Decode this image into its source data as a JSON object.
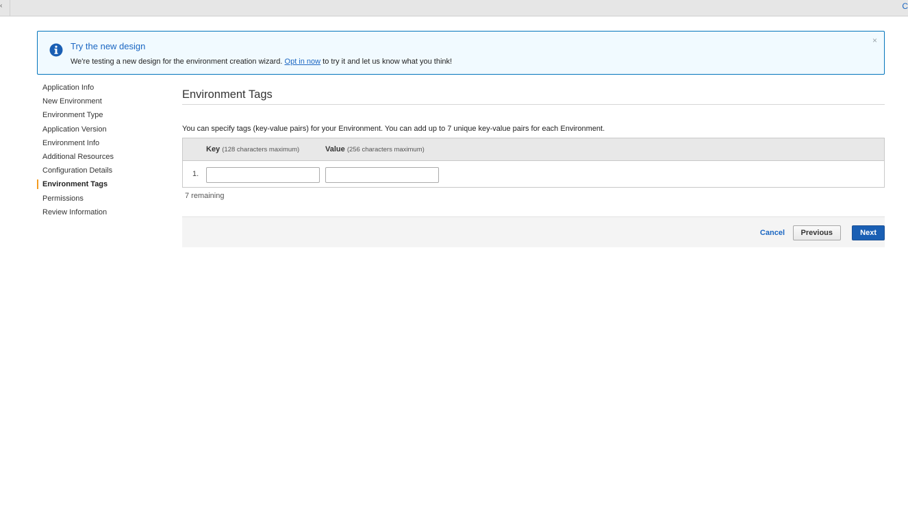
{
  "colors": {
    "accent": "#1a66c2",
    "banner_border": "#0073bb",
    "banner_bg": "#f1faff",
    "nav_active_marker": "#f39b20",
    "primary_button": "#1a5fb4"
  },
  "topbar": {
    "left_glyph": "‹",
    "right_glyph": "C"
  },
  "banner": {
    "icon": "info-icon",
    "title": "Try the new design",
    "message_before": "We're testing a new design for the environment creation wizard.",
    "link_text": "Opt in now",
    "message_after": "to try it and let us know what you think!",
    "close_label": "×"
  },
  "sidebar": {
    "items": [
      {
        "label": "Application Info",
        "active": false
      },
      {
        "label": "New Environment",
        "active": false
      },
      {
        "label": "Environment Type",
        "active": false
      },
      {
        "label": "Application Version",
        "active": false
      },
      {
        "label": "Environment Info",
        "active": false
      },
      {
        "label": "Additional Resources",
        "active": false
      },
      {
        "label": "Configuration Details",
        "active": false
      },
      {
        "label": "Environment Tags",
        "active": true
      },
      {
        "label": "Permissions",
        "active": false
      },
      {
        "label": "Review Information",
        "active": false
      }
    ]
  },
  "main": {
    "title": "Environment Tags",
    "description": "You can specify tags (key-value pairs) for your Environment. You can add up to 7 unique key-value pairs for each Environment.",
    "table": {
      "key_header": "Key",
      "key_hint": "(128 characters maximum)",
      "value_header": "Value",
      "value_hint": "(256 characters maximum)",
      "rows": [
        {
          "number": "1.",
          "key": "",
          "value": ""
        }
      ]
    },
    "remaining": "7 remaining"
  },
  "footer": {
    "cancel_label": "Cancel",
    "previous_label": "Previous",
    "next_label": "Next"
  }
}
